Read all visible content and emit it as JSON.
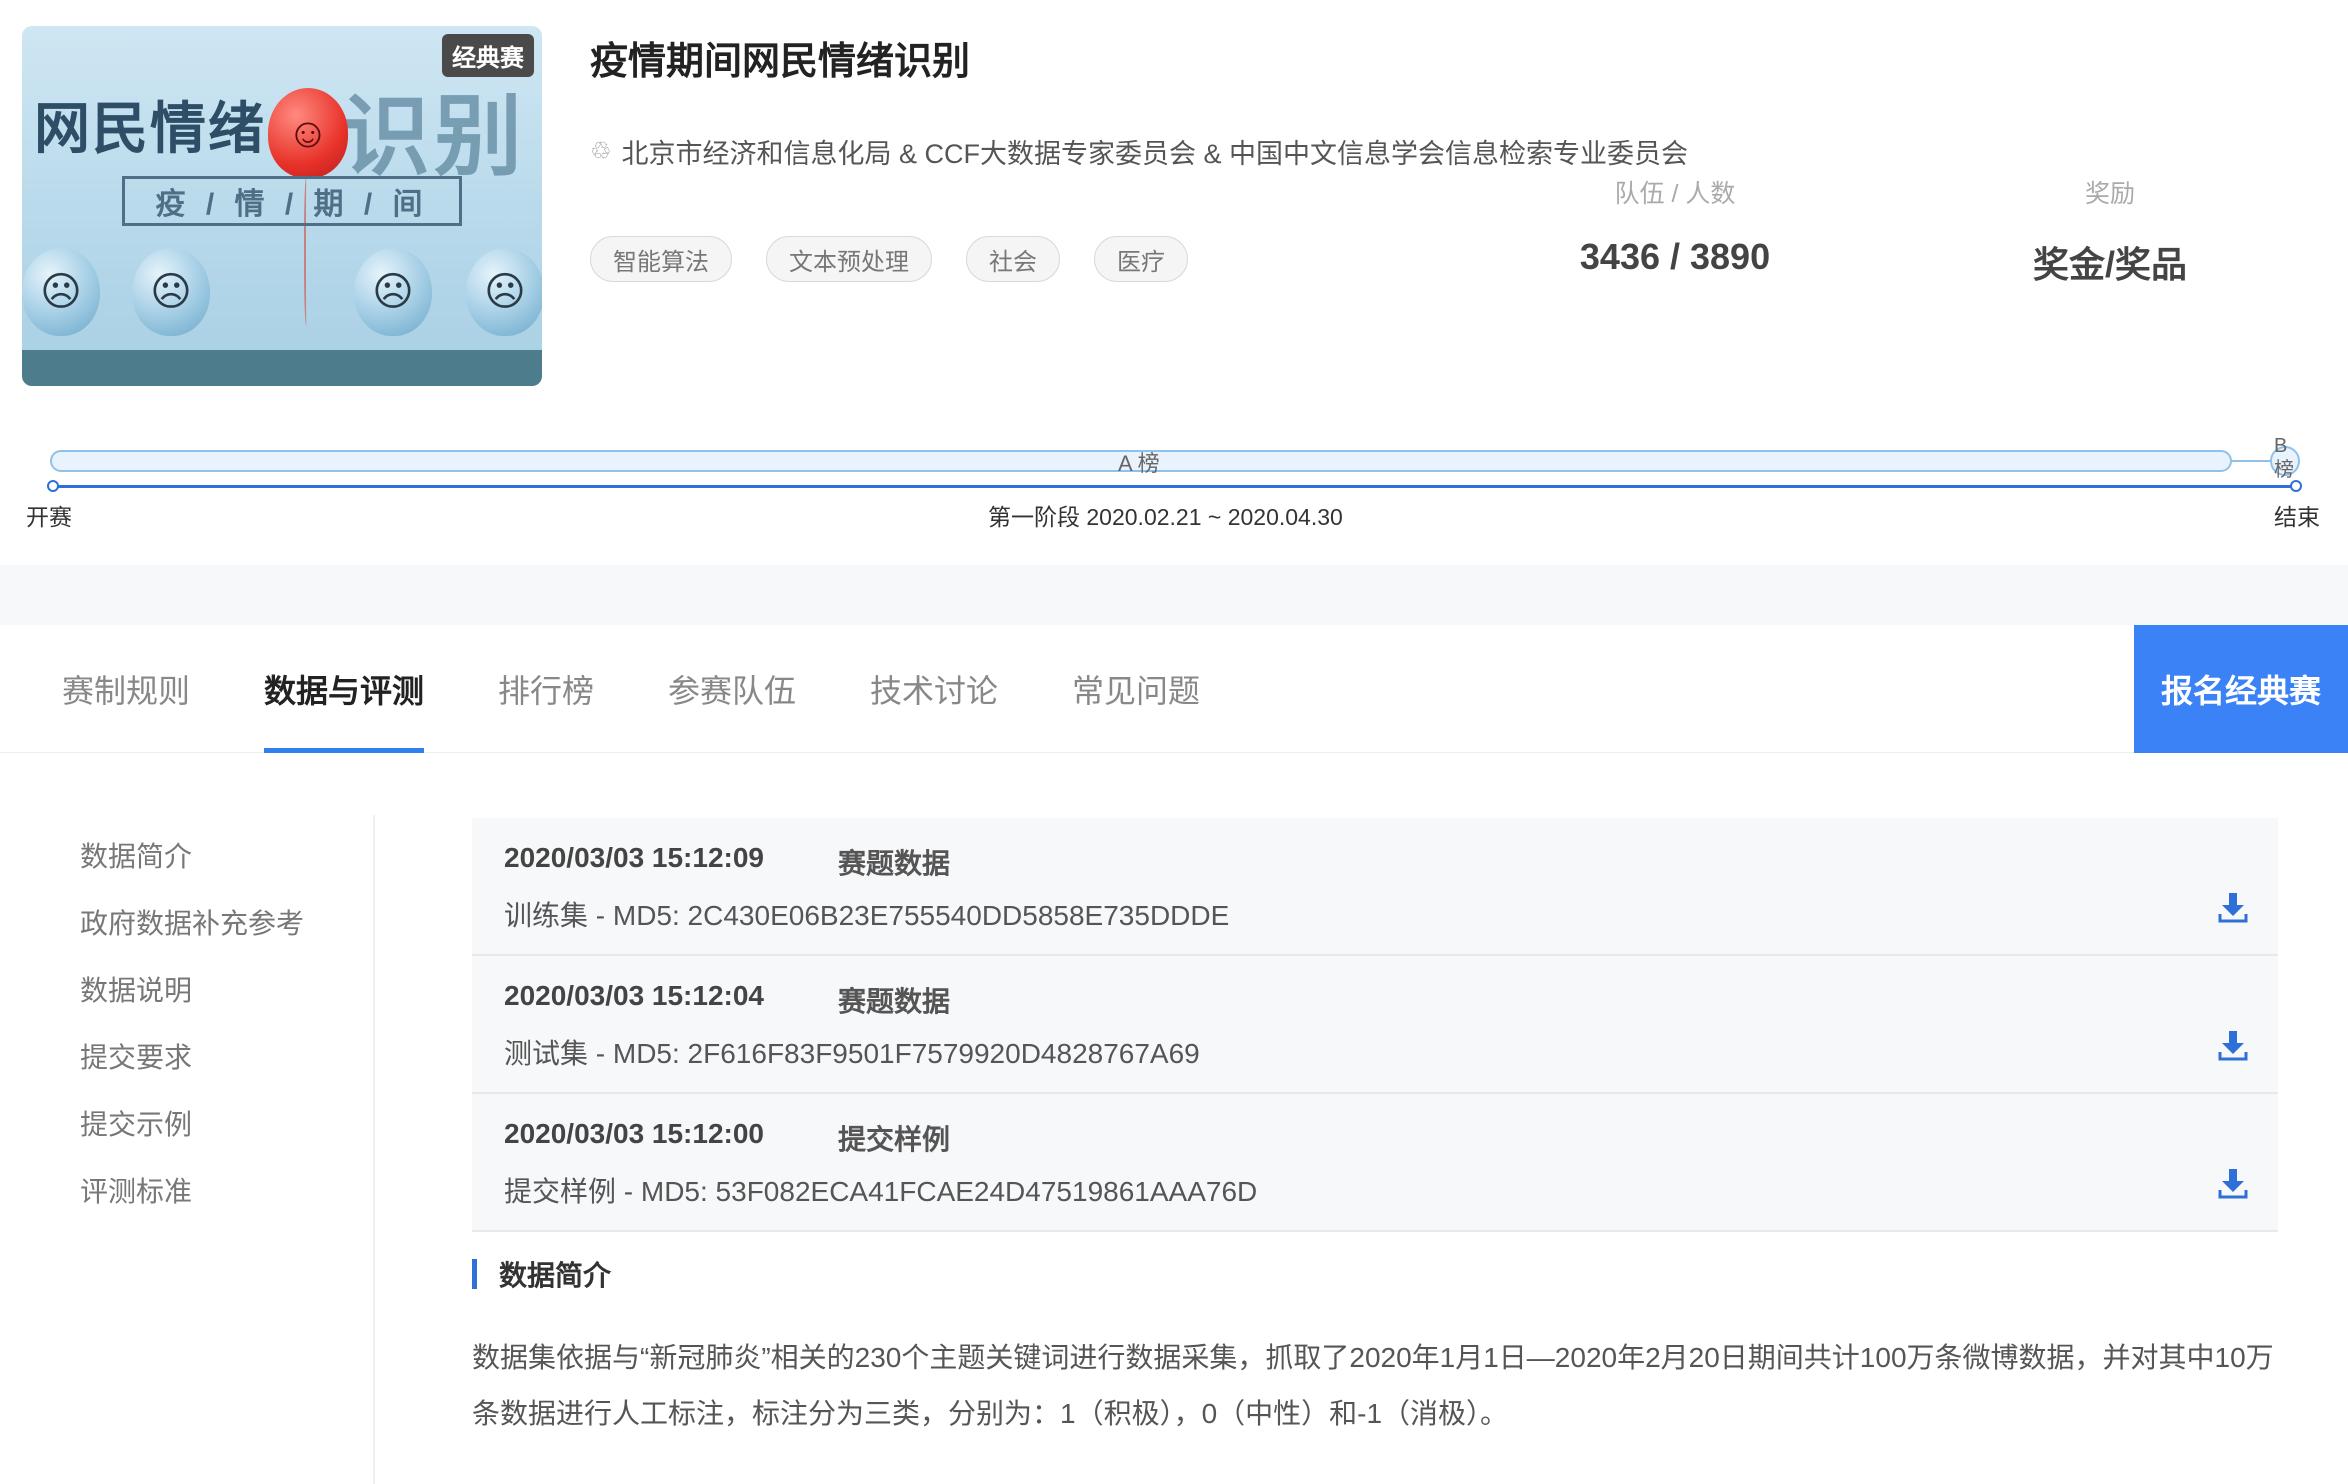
{
  "competition": {
    "badge": "经典赛",
    "banner_text_left": "网民情绪",
    "banner_text_right": "识别",
    "banner_subtitle": "疫 / 情 / 期 / 间",
    "title": "疫情期间网民情绪识别",
    "organizers": "北京市经济和信息化局 & CCF大数据专家委员会 & 中国中文信息学会信息检索专业委员会",
    "tags": [
      "智能算法",
      "文本预处理",
      "社会",
      "医疗"
    ],
    "stats": {
      "teams_label": "队伍 / 人数",
      "teams_value": "3436 / 3890",
      "reward_label": "奖励",
      "reward_value": "奖金/奖品"
    }
  },
  "timeline": {
    "a_label": "A 榜",
    "b_label": "B榜",
    "start_label": "开赛",
    "end_label": "结束",
    "phase_label": "第一阶段 2020.02.21 ~ 2020.04.30"
  },
  "tabs": [
    {
      "label": "赛制规则",
      "active": false
    },
    {
      "label": "数据与评测",
      "active": true
    },
    {
      "label": "排行榜",
      "active": false
    },
    {
      "label": "参赛队伍",
      "active": false
    },
    {
      "label": "技术讨论",
      "active": false
    },
    {
      "label": "常见问题",
      "active": false
    }
  ],
  "signup_label": "报名经典赛",
  "sidebar": {
    "items": [
      "数据简介",
      "政府数据补充参考",
      "数据说明",
      "提交要求",
      "提交示例",
      "评测标准"
    ]
  },
  "files": [
    {
      "timestamp": "2020/03/03 15:12:09",
      "kind": "赛题数据",
      "md5_line": "训练集 - MD5: 2C430E06B23E755540DD5858E735DDDE"
    },
    {
      "timestamp": "2020/03/03 15:12:04",
      "kind": "赛题数据",
      "md5_line": "测试集 - MD5: 2F616F83F9501F7579920D4828767A69"
    },
    {
      "timestamp": "2020/03/03 15:12:00",
      "kind": "提交样例",
      "md5_line": "提交样例 - MD5: 53F082ECA41FCAE24D47519861AAA76D"
    }
  ],
  "section": {
    "title": "数据简介",
    "description": "数据集依据与“新冠肺炎”相关的230个主题关键词进行数据采集，抓取了2020年1月1日—2020年2月20日期间共计100万条微博数据，并对其中10万条数据进行人工标注，标注分为三类，分别为：1（积极），0（中性）和-1（消极）。"
  },
  "colors": {
    "accent": "#3b82f6",
    "timeline": "#2f6fd8",
    "tab_underline": "#2f80ed"
  }
}
